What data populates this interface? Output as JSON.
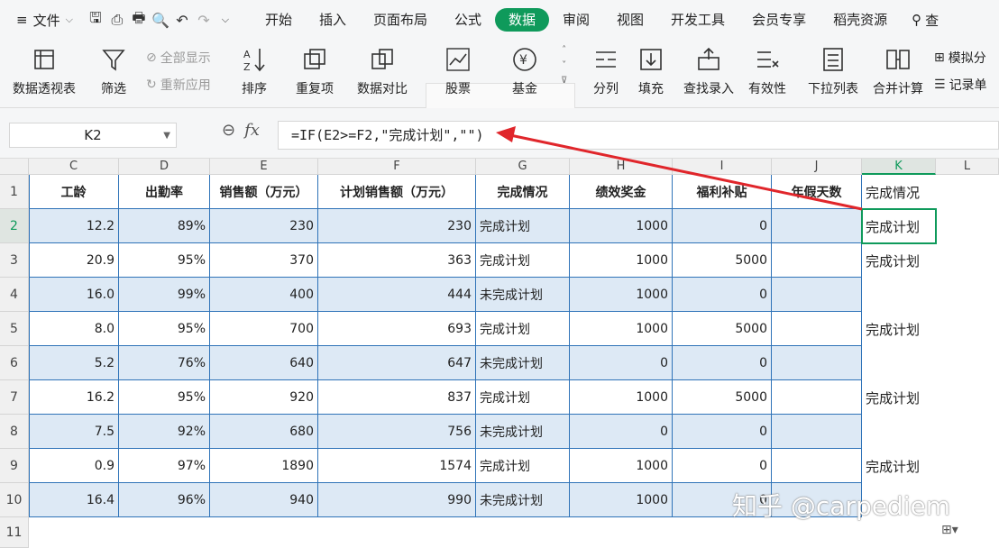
{
  "menubar": {
    "file_label": "文件",
    "tabs": [
      "开始",
      "插入",
      "页面布局",
      "公式",
      "数据",
      "审阅",
      "视图",
      "开发工具",
      "会员专享",
      "稻壳资源"
    ],
    "active_tab": "数据",
    "search_label": "查"
  },
  "ribbon": {
    "pivot": "数据透视表",
    "filter": "筛选",
    "show_all": "全部显示",
    "reapply": "重新应用",
    "sort": "排序",
    "duplicates": "重复项",
    "compare": "数据对比",
    "stocks": "股票",
    "funds": "基金",
    "split": "分列",
    "fill": "填充",
    "lookup": "查找录入",
    "validity": "有效性",
    "dropdown": "下拉列表",
    "merge_calc": "合并计算",
    "simulate": "模拟分",
    "record": "记录单"
  },
  "formula_bar": {
    "cell_ref": "K2",
    "fx": "fx",
    "formula": "=IF(E2>=F2,\"完成计划\",\"\")"
  },
  "columns": [
    "C",
    "D",
    "E",
    "F",
    "G",
    "H",
    "I",
    "J",
    "K",
    "L"
  ],
  "rows": [
    "1",
    "2",
    "3",
    "4",
    "5",
    "6",
    "7",
    "8",
    "9",
    "10",
    "11"
  ],
  "headers": [
    "工龄",
    "出勤率",
    "销售额（万元）",
    "计划销售额（万元）",
    "完成情况",
    "绩效奖金",
    "福利补贴",
    "年假天数"
  ],
  "k_header": "完成情况",
  "table": [
    {
      "c": "12.2",
      "d": "89%",
      "e": "230",
      "f": "230",
      "g": "完成计划",
      "h": "1000",
      "i": "0",
      "j": "",
      "k": "完成计划"
    },
    {
      "c": "20.9",
      "d": "95%",
      "e": "370",
      "f": "363",
      "g": "完成计划",
      "h": "1000",
      "i": "5000",
      "j": "",
      "k": "完成计划"
    },
    {
      "c": "16.0",
      "d": "99%",
      "e": "400",
      "f": "444",
      "g": "未完成计划",
      "h": "1000",
      "i": "0",
      "j": "",
      "k": ""
    },
    {
      "c": "8.0",
      "d": "95%",
      "e": "700",
      "f": "693",
      "g": "完成计划",
      "h": "1000",
      "i": "5000",
      "j": "",
      "k": "完成计划"
    },
    {
      "c": "5.2",
      "d": "76%",
      "e": "640",
      "f": "647",
      "g": "未完成计划",
      "h": "0",
      "i": "0",
      "j": "",
      "k": ""
    },
    {
      "c": "16.2",
      "d": "95%",
      "e": "920",
      "f": "837",
      "g": "完成计划",
      "h": "1000",
      "i": "5000",
      "j": "",
      "k": "完成计划"
    },
    {
      "c": "7.5",
      "d": "92%",
      "e": "680",
      "f": "756",
      "g": "未完成计划",
      "h": "0",
      "i": "0",
      "j": "",
      "k": ""
    },
    {
      "c": "0.9",
      "d": "97%",
      "e": "1890",
      "f": "1574",
      "g": "完成计划",
      "h": "1000",
      "i": "0",
      "j": "",
      "k": "完成计划"
    },
    {
      "c": "16.4",
      "d": "96%",
      "e": "940",
      "f": "990",
      "g": "未完成计划",
      "h": "1000",
      "i": "0",
      "j": "",
      "k": ""
    }
  ],
  "watermark": "知乎 @carpediem",
  "colors": {
    "accent": "#0f9a5b",
    "table_border": "#2f73b8",
    "band": "#dde9f5",
    "arrow": "#e0262b"
  }
}
